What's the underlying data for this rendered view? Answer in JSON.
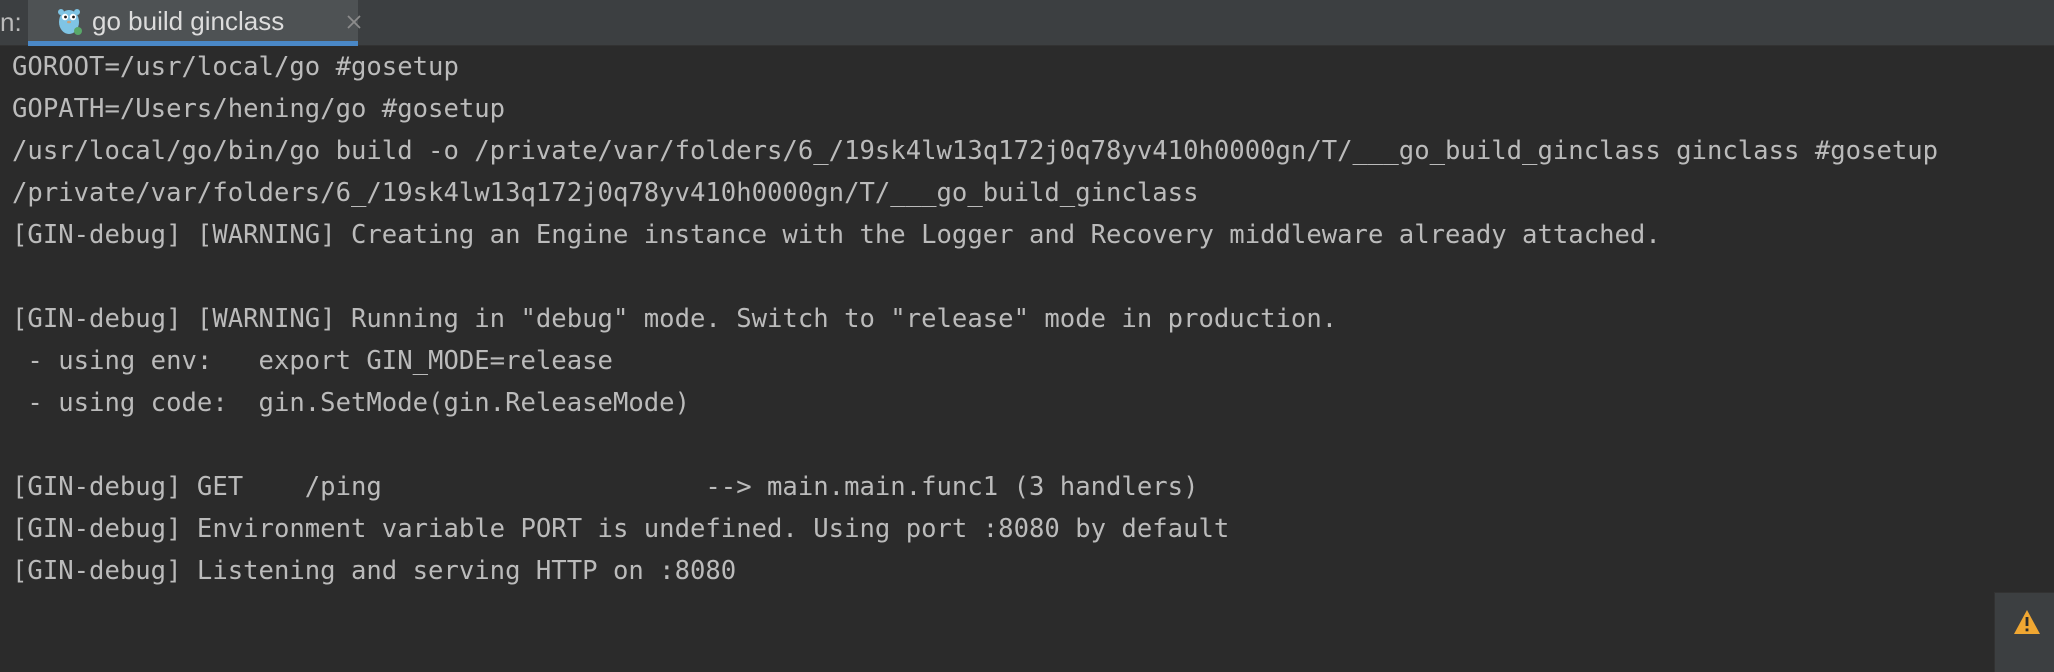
{
  "tabbar": {
    "run_prefix": "n:",
    "tabs": [
      {
        "label": "go build ginclass",
        "icon": "gopher-icon",
        "active": true
      }
    ]
  },
  "console": {
    "lines": [
      "GOROOT=/usr/local/go #gosetup",
      "GOPATH=/Users/hening/go #gosetup",
      "/usr/local/go/bin/go build -o /private/var/folders/6_/19sk4lw13q172j0q78yv410h0000gn/T/___go_build_ginclass ginclass #gosetup",
      "/private/var/folders/6_/19sk4lw13q172j0q78yv410h0000gn/T/___go_build_ginclass",
      "[GIN-debug] [WARNING] Creating an Engine instance with the Logger and Recovery middleware already attached.",
      "",
      "[GIN-debug] [WARNING] Running in \"debug\" mode. Switch to \"release\" mode in production.",
      " - using env:   export GIN_MODE=release",
      " - using code:  gin.SetMode(gin.ReleaseMode)",
      "",
      "[GIN-debug] GET    /ping                     --> main.main.func1 (3 handlers)",
      "[GIN-debug] Environment variable PORT is undefined. Using port :8080 by default",
      "[GIN-debug] Listening and serving HTTP on :8080"
    ]
  },
  "colors": {
    "background": "#2b2b2b",
    "tabbar": "#3c3f41",
    "active_tab": "#4e5254",
    "accent": "#4a88c7",
    "text": "#bbbbbb",
    "warning": "#f0a732"
  },
  "side_panel": {
    "icon": "warning-icon"
  }
}
